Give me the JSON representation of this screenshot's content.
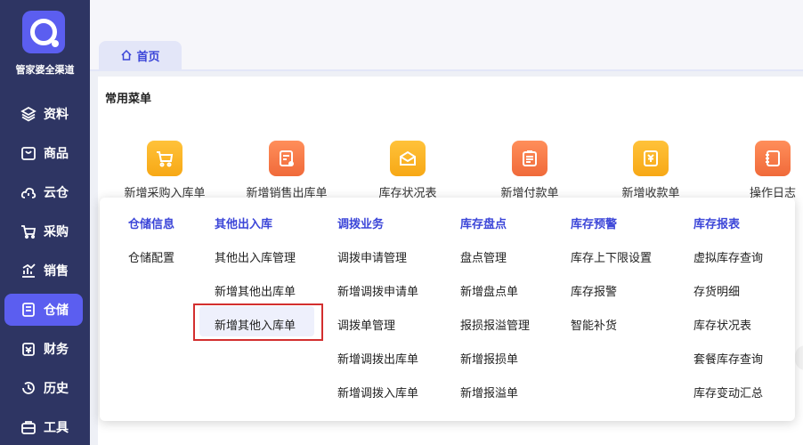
{
  "sidebar": {
    "brand": "管家婆全渠道",
    "items": [
      {
        "label": "资料",
        "icon": "layers-icon"
      },
      {
        "label": "商品",
        "icon": "shop-icon"
      },
      {
        "label": "云仓",
        "icon": "cloud-icon"
      },
      {
        "label": "采购",
        "icon": "cart-icon"
      },
      {
        "label": "销售",
        "icon": "chart-icon"
      },
      {
        "label": "仓储",
        "icon": "warehouse-icon",
        "active": true
      },
      {
        "label": "财务",
        "icon": "finance-icon"
      },
      {
        "label": "历史",
        "icon": "history-icon"
      },
      {
        "label": "工具",
        "icon": "toolbox-icon"
      }
    ]
  },
  "tabs": [
    {
      "label": "首页",
      "icon": "home-icon"
    }
  ],
  "common_menu": {
    "title": "常用菜单",
    "items": [
      {
        "label": "新增采购入库单",
        "color": "#f7a815"
      },
      {
        "label": "新增销售出库单",
        "color": "#f06a3a"
      },
      {
        "label": "库存状况表",
        "color": "#f7a815"
      },
      {
        "label": "新增付款单",
        "color": "#f06a3a"
      },
      {
        "label": "新增收款单",
        "color": "#f7a815"
      },
      {
        "label": "操作日志",
        "color": "#f06a3a"
      }
    ]
  },
  "dropdown": {
    "columns": [
      {
        "header": "仓储信息",
        "items": [
          "仓储配置"
        ]
      },
      {
        "header": "其他出入库",
        "items": [
          "其他出入库管理",
          "新增其他出库单",
          "新增其他入库单"
        ]
      },
      {
        "header": "调拨业务",
        "items": [
          "调拨申请管理",
          "新增调拨申请单",
          "调拨单管理",
          "新增调拨出库单",
          "新增调拨入库单"
        ]
      },
      {
        "header": "库存盘点",
        "items": [
          "盘点管理",
          "新增盘点单",
          "报损报溢管理",
          "新增报损单",
          "新增报溢单"
        ]
      },
      {
        "header": "库存预警",
        "items": [
          "库存上下限设置",
          "库存报警",
          "智能补货"
        ]
      },
      {
        "header": "库存报表",
        "items": [
          "虚拟库存查询",
          "存货明细",
          "库存状况表",
          "套餐库存查询",
          "库存变动汇总"
        ]
      }
    ]
  },
  "colors": {
    "sidebar": "#2e3563",
    "accent": "#5b5ef0",
    "header_text": "#3b45d8",
    "highlight_border": "#d32f2f"
  }
}
